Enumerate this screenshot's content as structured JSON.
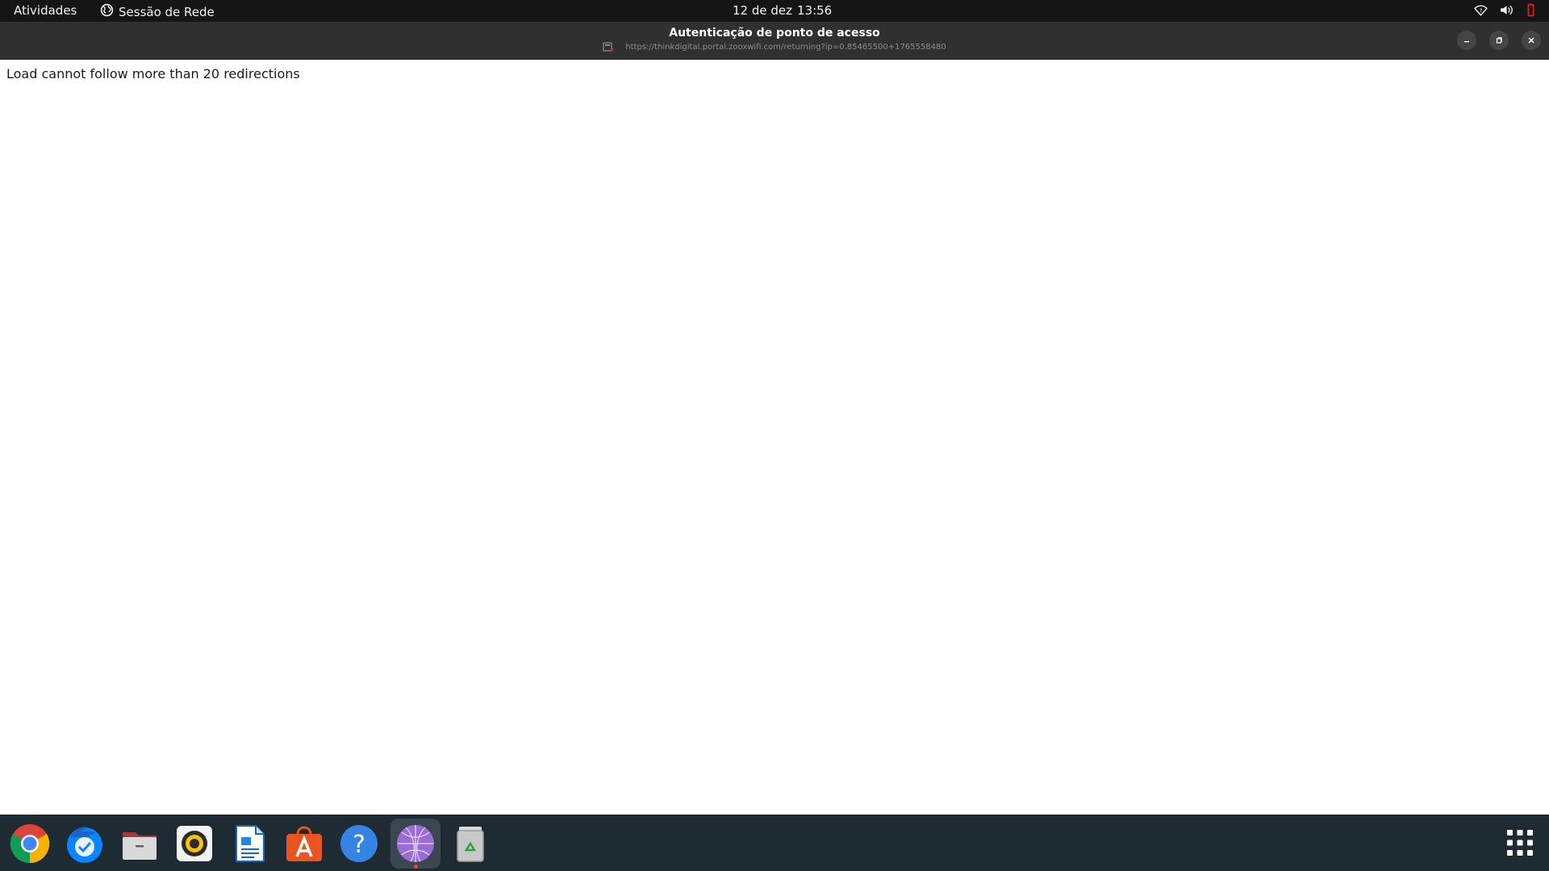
{
  "topbar": {
    "activities_label": "Atividades",
    "network_session_label": "Sessão de Rede",
    "date": "12 de dez",
    "time": "13:56",
    "tray_icons": [
      "network-question-icon",
      "volume-icon",
      "power-icon"
    ]
  },
  "window": {
    "title": "Autenticação de ponto de acesso",
    "url": "https://thinkdigital.portal.zooxwifi.com/returning?ip=0.85465500+1765558480",
    "controls": [
      "minimize-icon",
      "restore-icon",
      "close-icon"
    ]
  },
  "content": {
    "error_message": "Load cannot follow more than 20 redirections"
  },
  "dock": {
    "apps": [
      {
        "name": "chrome-icon"
      },
      {
        "name": "thunderbird-icon"
      },
      {
        "name": "files-icon"
      },
      {
        "name": "rhythmbox-icon"
      },
      {
        "name": "writer-icon"
      },
      {
        "name": "app-center-icon"
      },
      {
        "name": "help-icon"
      },
      {
        "name": "network-browser-icon",
        "active": true
      },
      {
        "name": "trash-icon"
      }
    ],
    "show_apps_icon": "grid-icon"
  },
  "colors": {
    "topbar_bg": "#151515",
    "headerbar_bg": "#303030",
    "dock_bg": "#1f2b33",
    "accent": "#e95420"
  }
}
